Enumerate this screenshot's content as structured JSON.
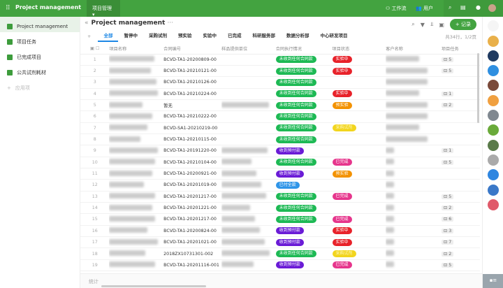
{
  "topbar": {
    "app_title": "Project management",
    "module": "项目管理",
    "workflow": "工作流",
    "users": "用户"
  },
  "sidebar": {
    "items": [
      "Project management",
      "项目任务",
      "已完成项目",
      "公共试剂耗材"
    ],
    "add": "应用项"
  },
  "header": {
    "title": "Project management",
    "new_record": "+ 记录",
    "page_info": "共34行，1/2页"
  },
  "tabs": [
    "全部",
    "暂停中",
    "采购试剂",
    "预实验",
    "实验中",
    "已完成",
    "科研服务部",
    "数据分析部",
    "中心研发项目"
  ],
  "columns": [
    "项目名称",
    "合同编号",
    "样品提供单位",
    "合同执行情况",
    "项目状态",
    "客户名称",
    "项目任务"
  ],
  "colors": {
    "未收到任何合同款": "#1db954",
    "收到预付款": "#6a1bd6",
    "已付全款": "#2f95e8",
    "实验中": "#e8222a",
    "预实验": "#f39200",
    "采购试剂": "#f2d51e",
    "已完成": "#e6358c"
  },
  "rows": [
    {
      "no": "1",
      "contract": "BCVD-TA1-20200809-00",
      "exec": "未收到任何合同款",
      "status": "实验中",
      "tasks": "5"
    },
    {
      "no": "2",
      "contract": "BCVD-TA1-20210121-00",
      "exec": "未收到任何合同款",
      "status": "实验中",
      "tasks": "5"
    },
    {
      "no": "3",
      "contract": "BCVD-TA1-20210126-00",
      "exec": "未收到任何合同款",
      "status": "",
      "tasks": ""
    },
    {
      "no": "4",
      "contract": "BCVD-TA1-20210224-00",
      "exec": "未收到任何合同款",
      "status": "实验中",
      "tasks": "1"
    },
    {
      "no": "5",
      "contract": "暂无",
      "exec": "未收到任何合同款",
      "status": "预实验",
      "tasks": "2"
    },
    {
      "no": "6",
      "contract": "BCVD-TA1-20210222-00",
      "exec": "未收到任何合同款",
      "status": "",
      "tasks": ""
    },
    {
      "no": "7",
      "contract": "BCVD-SA1-20210219-00",
      "exec": "未收到任何合同款",
      "status": "采购试剂",
      "tasks": ""
    },
    {
      "no": "8",
      "contract": "BCVD-TA1-20210115-00",
      "exec": "未收到任何合同款",
      "status": "",
      "tasks": ""
    },
    {
      "no": "9",
      "contract": "BCVD-TA1-20191220-00",
      "exec": "收到预付款",
      "status": "",
      "tasks": "1"
    },
    {
      "no": "10",
      "contract": "BCVD-TA1-20210104-00",
      "exec": "未收到任何合同款",
      "status": "已完成",
      "tasks": "5"
    },
    {
      "no": "11",
      "contract": "BCVD-TA1-20200921-00",
      "exec": "收到预付款",
      "status": "预实验",
      "tasks": ""
    },
    {
      "no": "12",
      "contract": "BCVD-TA1-20201019-00",
      "exec": "已付全款",
      "status": "",
      "tasks": ""
    },
    {
      "no": "13",
      "contract": "BCVD-TA1-20201217-00",
      "exec": "未收到任何合同款",
      "status": "已完成",
      "tasks": "5"
    },
    {
      "no": "14",
      "contract": "BCVD-TA1-20201221-00",
      "exec": "未收到任何合同款",
      "status": "",
      "tasks": "2"
    },
    {
      "no": "15",
      "contract": "BCVD-TA1-20201217-00",
      "exec": "未收到任何合同款",
      "status": "已完成",
      "tasks": "6"
    },
    {
      "no": "16",
      "contract": "BCVD-TA1-20200824-00",
      "exec": "收到预付款",
      "status": "实验中",
      "tasks": "3"
    },
    {
      "no": "17",
      "contract": "BCVD-TA1-20201021-00",
      "exec": "收到预付款",
      "status": "实验中",
      "tasks": "7"
    },
    {
      "no": "18",
      "contract": "2018ZX10731301-002",
      "exec": "未收到任何合同款",
      "status": "采购试剂",
      "tasks": "2"
    },
    {
      "no": "19",
      "contract": "BCVD-TA1-20201116-001",
      "exec": "收到预付款",
      "status": "已完成",
      "tasks": "5"
    }
  ],
  "footer": {
    "label": "统计"
  }
}
